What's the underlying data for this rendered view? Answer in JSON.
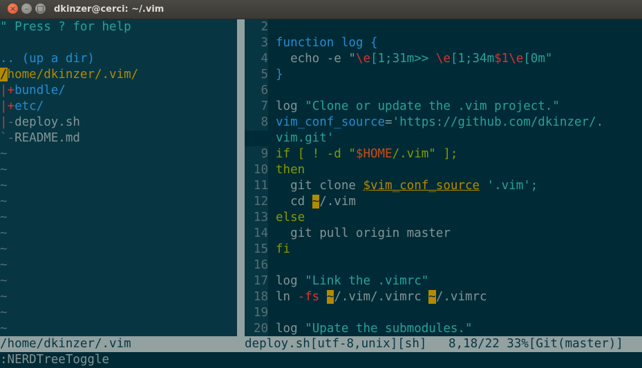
{
  "window": {
    "title": "dkinzer@cerci: ~/.vim",
    "close_glyph": "×",
    "min_glyph": "–",
    "max_glyph": "□"
  },
  "nerdtree": {
    "help_hint": "\" Press ? for help",
    "up_dir": ".. (up a dir)",
    "root_cursor": "/",
    "root_rest": "home/dkinzer/.vim/",
    "entries": [
      {
        "prefix": "|",
        "marker": "+",
        "name": "bundle/"
      },
      {
        "prefix": "|",
        "marker": "+",
        "name": "etc/"
      },
      {
        "prefix": "|",
        "marker": "-",
        "name": "deploy.sh"
      },
      {
        "prefix": "`",
        "marker": "-",
        "name": "README.md"
      }
    ],
    "tilde": "~"
  },
  "editor": {
    "line_numbers": [
      "2",
      "3",
      "4",
      "5",
      "6",
      "7",
      "8",
      "",
      "9",
      "10",
      "11",
      "12",
      "13",
      "14",
      "15",
      "16",
      "17",
      "18",
      "19",
      "20"
    ],
    "lines": {
      "l3_kw": "function",
      "l3_name": " log {",
      "l4_a": "  echo -e \"",
      "l4_b": "\\e",
      "l4_c": "[1;31m>> ",
      "l4_d": "\\e",
      "l4_e": "[1;34m",
      "l4_f": "$1",
      "l4_g": "\\e",
      "l4_h": "[0m\"",
      "l5": "}",
      "l7_a": "log ",
      "l7_b": "\"Clone or update the .vim project.\"",
      "l8_a": "vim_conf_source",
      "l8_b": "=",
      "l8_c": "'https://github.com/dkinzer/.",
      "l8_wrap": "vim.git'",
      "l9_a": "if [ ! -d \"",
      "l9_b": "$HOME",
      "l9_c": "/.vim\" ];",
      "l10": "then",
      "l11_a": "  git clone ",
      "l11_b": "$vim_conf_source",
      "l11_c": " '.vim';",
      "l12_a": "  cd ",
      "l12_b": "~",
      "l12_c": "/.vim",
      "l13": "else",
      "l14": "  git pull origin master",
      "l15": "fi",
      "l17_a": "log ",
      "l17_b": "\"Link the .vimrc\"",
      "l18_a": "ln ",
      "l18_b": "-fs",
      "l18_c": " ",
      "l18_d": "~",
      "l18_e": "/.vim/.vimrc ",
      "l18_f": "~",
      "l18_g": "/.vimrc",
      "l20_a": "log ",
      "l20_b": "\"Upate the submodules.\""
    }
  },
  "statusline": {
    "left": "/home/dkinzer/.vim",
    "right": "deploy.sh[utf-8,unix][sh]   8,18/22 33%[Git(master)]"
  },
  "command_line": ":NERDTreeToggle",
  "colors": {
    "background": "#002b36",
    "keyword": "#268bd2",
    "string": "#2aa198",
    "conditional": "#859900",
    "escape": "#dc322f",
    "variable": "#b58900"
  }
}
